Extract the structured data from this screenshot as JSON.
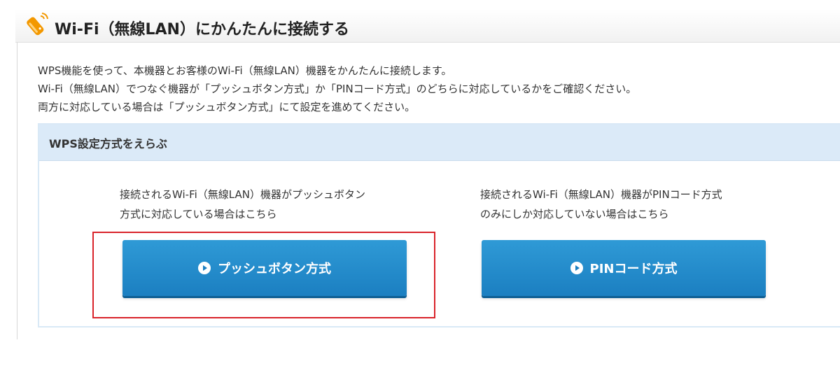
{
  "header": {
    "title": "Wi-Fi（無線LAN）にかんたんに接続する",
    "icon": "pencil-icon",
    "icon_color": "#f39800"
  },
  "intro": {
    "lines": [
      "WPS機能を使って、本機器とお客様のWi-Fi（無線LAN）機器をかんたんに接続します。",
      "Wi-Fi（無線LAN）でつなぐ機器が「プッシュボタン方式」か「PINコード方式」のどちらに対応しているかをご確認ください。",
      "両方に対応している場合は「プッシュボタン方式」にて設定を進めてください。"
    ]
  },
  "wps": {
    "title": "WPS設定方式をえらぶ",
    "options": [
      {
        "desc_lines": [
          "接続されるWi-Fi（無線LAN）機器がプッシュボタン",
          "方式に対応している場合はこちら"
        ],
        "button_label": "プッシュボタン方式",
        "button_icon": "play-circle-icon",
        "highlighted": true
      },
      {
        "desc_lines": [
          "接続されるWi-Fi（無線LAN）機器がPINコード方式",
          "のみにしか対応していない場合はこちら"
        ],
        "button_label": "PINコード方式",
        "button_icon": "play-circle-icon",
        "highlighted": false
      }
    ]
  },
  "colors": {
    "button": "#1b7fc1",
    "box_header": "#dbeaf8",
    "highlight": "#d9232a"
  }
}
